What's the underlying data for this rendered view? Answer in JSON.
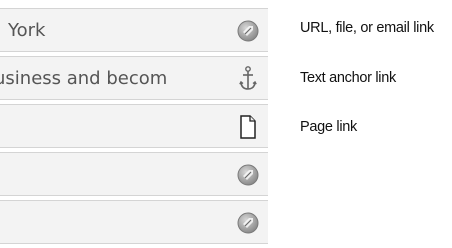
{
  "rows": [
    {
      "text": "York",
      "icon": "url-link-icon"
    },
    {
      "text": "usiness and becom",
      "icon": "anchor-icon"
    },
    {
      "text": "",
      "icon": "page-icon"
    },
    {
      "text": "",
      "icon": "url-link-icon"
    },
    {
      "text": "",
      "icon": "url-link-icon"
    }
  ],
  "legend": {
    "url_link": "URL, file, or email link",
    "anchor_link": "Text anchor link",
    "page_link": "Page link"
  },
  "colors": {
    "row_background": "#f3f3f3",
    "row_border": "#d4d4d4",
    "row_text": "#555555",
    "legend_text": "#111111"
  }
}
